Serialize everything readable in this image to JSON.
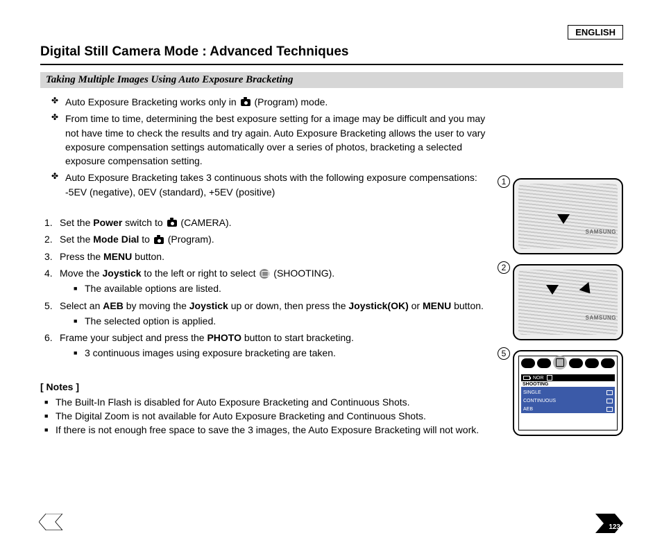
{
  "language_badge": "ENGLISH",
  "title": "Digital Still Camera Mode : Advanced Techniques",
  "subsection": "Taking Multiple Images Using Auto Exposure Bracketing",
  "bullets": [
    "Auto Exposure Bracketing works only in      (Program) mode.",
    "From time to time, determining the best exposure setting for a image may be difficult and you may not have time to check the results and try again. Auto Exposure Bracketing allows the user to vary exposure compensation settings automatically over a series of photos, bracketing a selected exposure compensation setting.",
    "Auto Exposure Bracketing takes 3 continuous shots with the following exposure compensations: -5EV (negative), 0EV (standard), +5EV (positive)"
  ],
  "steps": {
    "s1_a": "Set the ",
    "s1_b": "Power",
    "s1_c": " switch to ",
    "s1_d": " (CAMERA).",
    "s2_a": "Set the ",
    "s2_b": "Mode Dial",
    "s2_c": " to ",
    "s2_d": " (Program).",
    "s3_a": "Press the ",
    "s3_b": "MENU",
    "s3_c": " button.",
    "s4_a": "Move the ",
    "s4_b": "Joystick",
    "s4_c": " to the left or right to select  ",
    "s4_d": " (SHOOTING).",
    "s4_sub": "The available options are listed.",
    "s5_a": "Select an ",
    "s5_b": "AEB",
    "s5_c": " by moving the ",
    "s5_d": "Joystick",
    "s5_e": " up or down, then press the ",
    "s5_f": "Joystick(OK)",
    "s5_g": " or ",
    "s5_h": "MENU",
    "s5_i": " button.",
    "s5_sub": "The selected option is applied.",
    "s6_a": "Frame your subject and press the ",
    "s6_b": "PHOTO",
    "s6_c": " button to start bracketing.",
    "s6_sub": "3 continuous images using exposure bracketing are taken."
  },
  "notes_title": "[ Notes ]",
  "notes": [
    "The Built-In Flash is disabled for Auto Exposure Bracketing and Continuous Shots.",
    "The Digital Zoom is not available for Auto Exposure Bracketing and Continuous Shots.",
    "If there is not enough free space to save the 3 images, the Auto Exposure Bracketing will not work."
  ],
  "figures": {
    "f1": "1",
    "f2": "2",
    "f5": "5",
    "brand": "SAMSUNG"
  },
  "lcd": {
    "nor": "NOR",
    "title": "SHOOTING",
    "items": [
      "SINGLE",
      "CONTINUOUS",
      "AEB"
    ]
  },
  "page_number": "123"
}
